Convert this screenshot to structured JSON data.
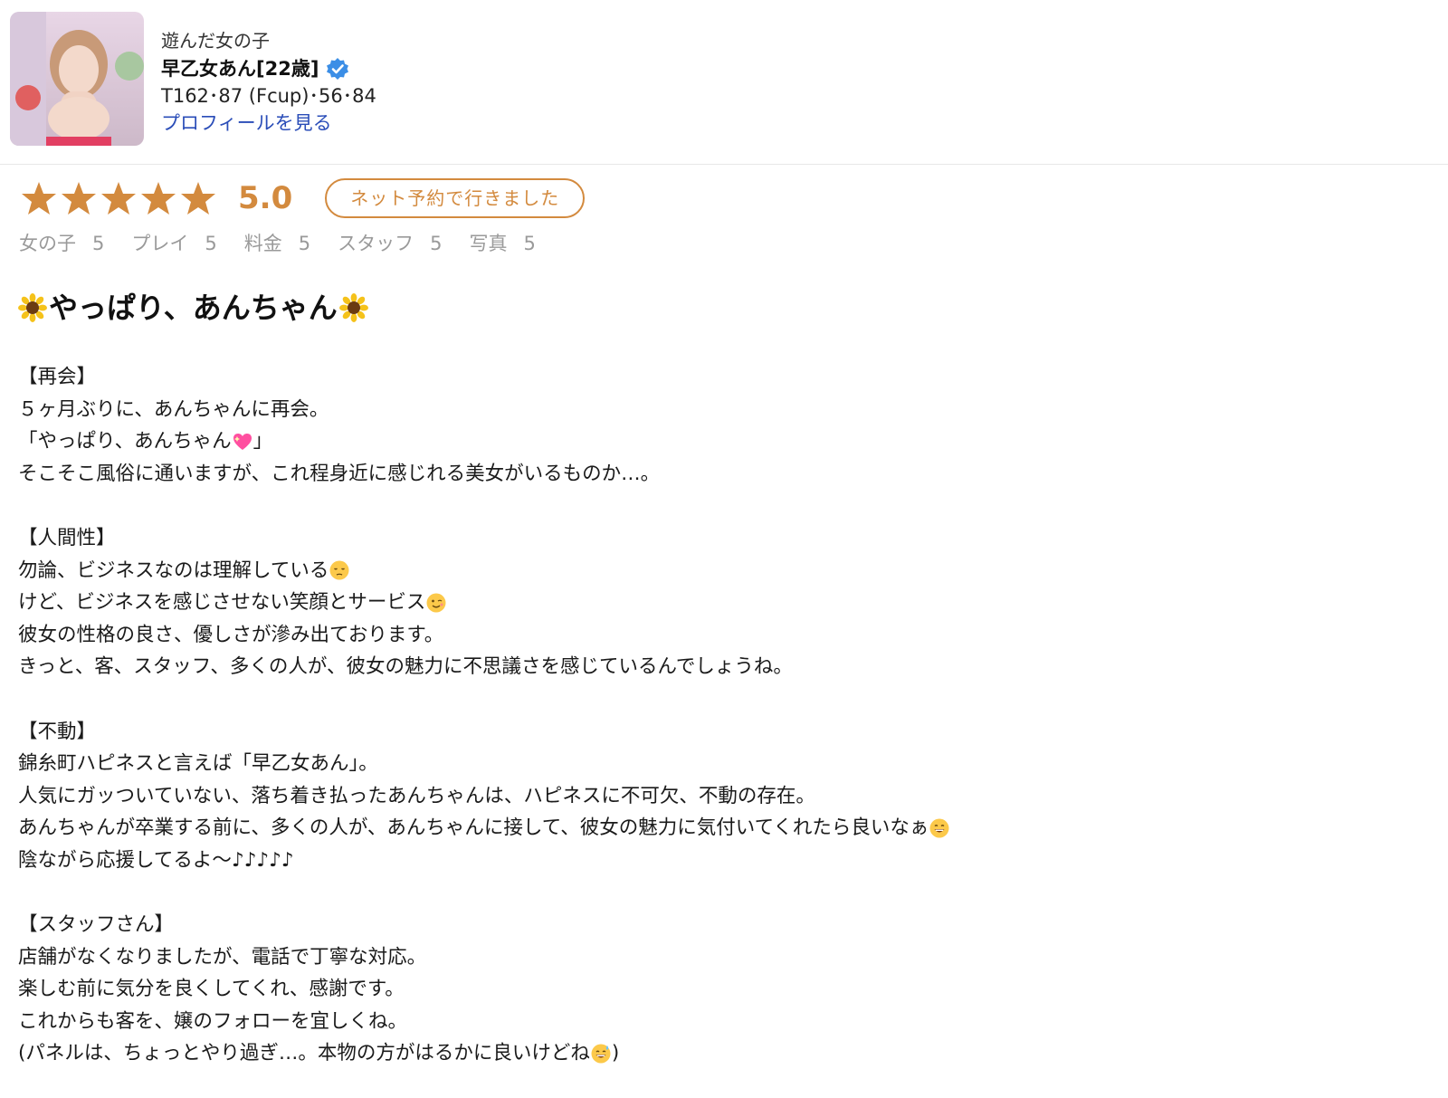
{
  "profile": {
    "caption": "遊んだ女の子",
    "name": "早乙女あん[22歳]",
    "measurements": "T162･87 (Fcup)･56･84",
    "link_label": "プロフィールを見る"
  },
  "rating": {
    "stars": 5,
    "score": "5.0",
    "badge": "ネット予約で行きました",
    "sub_ratings": [
      {
        "label": "女の子",
        "value": "5"
      },
      {
        "label": "プレイ",
        "value": "5"
      },
      {
        "label": "料金",
        "value": "5"
      },
      {
        "label": "スタッフ",
        "value": "5"
      },
      {
        "label": "写真",
        "value": "5"
      }
    ],
    "accent_color": "#d38a3e"
  },
  "review": {
    "title": "やっぱり、あんちゃん",
    "title_icon": "sunflower-icon",
    "sections": [
      {
        "heading": "【再会】",
        "lines": [
          {
            "text": "５ヶ月ぶりに、あんちゃんに再会。"
          },
          {
            "text": "「やっぱり、あんちゃん",
            "emoji": "sparkling-heart-icon",
            "after": "」"
          },
          {
            "text": "そこそこ風俗に通いますが、これ程身近に感じれる美女がいるものか…。"
          }
        ]
      },
      {
        "heading": "【人間性】",
        "lines": [
          {
            "text": "勿論、ビジネスなのは理解している",
            "emoji": "pensive-face-icon"
          },
          {
            "text": "けど、ビジネスを感じさせない笑顔とサービス",
            "emoji": "winking-face-icon"
          },
          {
            "text": "彼女の性格の良さ、優しさが滲み出ております。"
          },
          {
            "text": "きっと、客、スタッフ、多くの人が、彼女の魅力に不思議さを感じているんでしょうね。"
          }
        ]
      },
      {
        "heading": "【不動】",
        "lines": [
          {
            "text": "錦糸町ハピネスと言えば「早乙女あん」。"
          },
          {
            "text": "人気にガッついていない、落ち着き払ったあんちゃんは、ハピネスに不可欠、不動の存在。"
          },
          {
            "text": "あんちゃんが卒業する前に、多くの人が、あんちゃんに接して、彼女の魅力に気付いてくれたら良いなぁ",
            "emoji": "grinning-face-icon"
          },
          {
            "text": "陰ながら応援してるよ〜♪♪♪♪♪"
          }
        ]
      },
      {
        "heading": "【スタッフさん】",
        "lines": [
          {
            "text": "店舗がなくなりましたが、電話で丁寧な対応。"
          },
          {
            "text": "楽しむ前に気分を良くしてくれ、感謝です。"
          },
          {
            "text": "これからも客を、嬢のフォローを宜しくね。"
          },
          {
            "text": "(パネルは、ちょっとやり過ぎ…。本物の方がはるかに良いけどね",
            "emoji": "sweat-smile-icon",
            "after": ")"
          }
        ]
      }
    ]
  }
}
